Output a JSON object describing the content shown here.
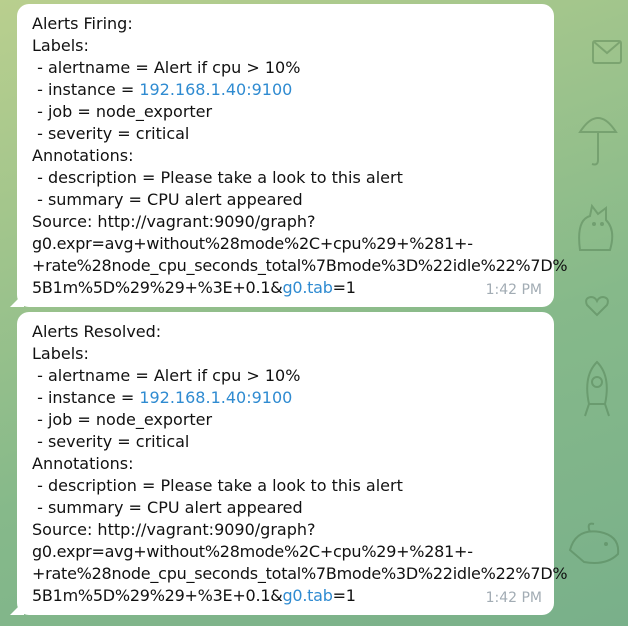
{
  "messages": [
    {
      "title": "Alerts Firing:",
      "labels_heading": "Labels:",
      "alertname": " - alertname = Alert if cpu > 10%",
      "instance_prefix": " - instance = ",
      "instance_link": "192.168.1.40:9100",
      "job": " - job = node_exporter",
      "severity": " - severity = critical",
      "annotations_heading": "Annotations:",
      "description": " - description = Please take a look to this alert",
      "summary": " - summary = CPU alert appeared",
      "source_label": "Source: http://vagrant:9090/graph?",
      "source_line1": "g0.expr=avg+without%28mode%2C+cpu%29+%281+-",
      "source_line2": "+rate%28node_cpu_seconds_total%7Bmode%3D%22idle%22%7D%",
      "source_line3_prefix": "5B1m%5D%29%29+%3E+0.1&",
      "source_link": "g0.tab",
      "source_suffix": "=1",
      "time": "1:42 PM"
    },
    {
      "title": "Alerts Resolved:",
      "labels_heading": "Labels:",
      "alertname": " - alertname = Alert if cpu > 10%",
      "instance_prefix": " - instance = ",
      "instance_link": "192.168.1.40:9100",
      "job": " - job = node_exporter",
      "severity": " - severity = critical",
      "annotations_heading": "Annotations:",
      "description": " - description = Please take a look to this alert",
      "summary": " - summary = CPU alert appeared",
      "source_label": "Source: http://vagrant:9090/graph?",
      "source_line1": "g0.expr=avg+without%28mode%2C+cpu%29+%281+-",
      "source_line2": "+rate%28node_cpu_seconds_total%7Bmode%3D%22idle%22%7D%",
      "source_line3_prefix": "5B1m%5D%29%29+%3E+0.1&",
      "source_link": "g0.tab",
      "source_suffix": "=1",
      "time": "1:42 PM"
    }
  ],
  "colors": {
    "link": "#2f8bd1",
    "time": "#a2acb4",
    "bubble": "#ffffff",
    "wallpaper": "#8fbd8b"
  },
  "icons": [
    "envelope-doodle-icon",
    "umbrella-doodle-icon",
    "cat-doodle-icon",
    "heart-doodle-icon",
    "whale-doodle-icon",
    "rocket-doodle-icon"
  ]
}
